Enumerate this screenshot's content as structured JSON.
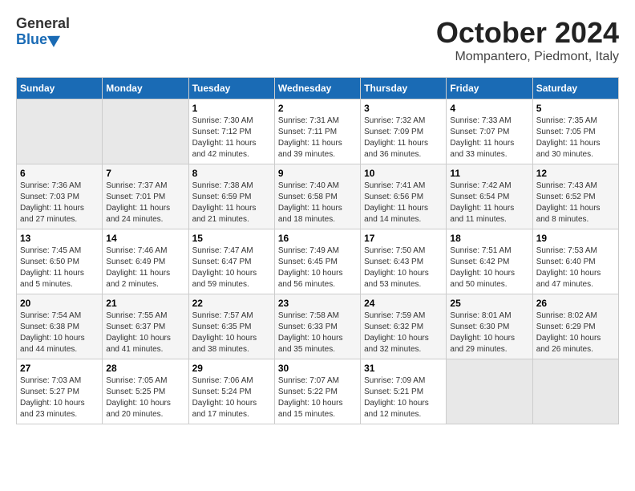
{
  "header": {
    "logo_general": "General",
    "logo_blue": "Blue",
    "title": "October 2024",
    "subtitle": "Mompantero, Piedmont, Italy"
  },
  "columns": [
    "Sunday",
    "Monday",
    "Tuesday",
    "Wednesday",
    "Thursday",
    "Friday",
    "Saturday"
  ],
  "weeks": [
    [
      {
        "day": "",
        "sunrise": "",
        "sunset": "",
        "daylight": "",
        "empty": true
      },
      {
        "day": "",
        "sunrise": "",
        "sunset": "",
        "daylight": "",
        "empty": true
      },
      {
        "day": "1",
        "sunrise": "Sunrise: 7:30 AM",
        "sunset": "Sunset: 7:12 PM",
        "daylight": "Daylight: 11 hours and 42 minutes."
      },
      {
        "day": "2",
        "sunrise": "Sunrise: 7:31 AM",
        "sunset": "Sunset: 7:11 PM",
        "daylight": "Daylight: 11 hours and 39 minutes."
      },
      {
        "day": "3",
        "sunrise": "Sunrise: 7:32 AM",
        "sunset": "Sunset: 7:09 PM",
        "daylight": "Daylight: 11 hours and 36 minutes."
      },
      {
        "day": "4",
        "sunrise": "Sunrise: 7:33 AM",
        "sunset": "Sunset: 7:07 PM",
        "daylight": "Daylight: 11 hours and 33 minutes."
      },
      {
        "day": "5",
        "sunrise": "Sunrise: 7:35 AM",
        "sunset": "Sunset: 7:05 PM",
        "daylight": "Daylight: 11 hours and 30 minutes."
      }
    ],
    [
      {
        "day": "6",
        "sunrise": "Sunrise: 7:36 AM",
        "sunset": "Sunset: 7:03 PM",
        "daylight": "Daylight: 11 hours and 27 minutes."
      },
      {
        "day": "7",
        "sunrise": "Sunrise: 7:37 AM",
        "sunset": "Sunset: 7:01 PM",
        "daylight": "Daylight: 11 hours and 24 minutes."
      },
      {
        "day": "8",
        "sunrise": "Sunrise: 7:38 AM",
        "sunset": "Sunset: 6:59 PM",
        "daylight": "Daylight: 11 hours and 21 minutes."
      },
      {
        "day": "9",
        "sunrise": "Sunrise: 7:40 AM",
        "sunset": "Sunset: 6:58 PM",
        "daylight": "Daylight: 11 hours and 18 minutes."
      },
      {
        "day": "10",
        "sunrise": "Sunrise: 7:41 AM",
        "sunset": "Sunset: 6:56 PM",
        "daylight": "Daylight: 11 hours and 14 minutes."
      },
      {
        "day": "11",
        "sunrise": "Sunrise: 7:42 AM",
        "sunset": "Sunset: 6:54 PM",
        "daylight": "Daylight: 11 hours and 11 minutes."
      },
      {
        "day": "12",
        "sunrise": "Sunrise: 7:43 AM",
        "sunset": "Sunset: 6:52 PM",
        "daylight": "Daylight: 11 hours and 8 minutes."
      }
    ],
    [
      {
        "day": "13",
        "sunrise": "Sunrise: 7:45 AM",
        "sunset": "Sunset: 6:50 PM",
        "daylight": "Daylight: 11 hours and 5 minutes."
      },
      {
        "day": "14",
        "sunrise": "Sunrise: 7:46 AM",
        "sunset": "Sunset: 6:49 PM",
        "daylight": "Daylight: 11 hours and 2 minutes."
      },
      {
        "day": "15",
        "sunrise": "Sunrise: 7:47 AM",
        "sunset": "Sunset: 6:47 PM",
        "daylight": "Daylight: 10 hours and 59 minutes."
      },
      {
        "day": "16",
        "sunrise": "Sunrise: 7:49 AM",
        "sunset": "Sunset: 6:45 PM",
        "daylight": "Daylight: 10 hours and 56 minutes."
      },
      {
        "day": "17",
        "sunrise": "Sunrise: 7:50 AM",
        "sunset": "Sunset: 6:43 PM",
        "daylight": "Daylight: 10 hours and 53 minutes."
      },
      {
        "day": "18",
        "sunrise": "Sunrise: 7:51 AM",
        "sunset": "Sunset: 6:42 PM",
        "daylight": "Daylight: 10 hours and 50 minutes."
      },
      {
        "day": "19",
        "sunrise": "Sunrise: 7:53 AM",
        "sunset": "Sunset: 6:40 PM",
        "daylight": "Daylight: 10 hours and 47 minutes."
      }
    ],
    [
      {
        "day": "20",
        "sunrise": "Sunrise: 7:54 AM",
        "sunset": "Sunset: 6:38 PM",
        "daylight": "Daylight: 10 hours and 44 minutes."
      },
      {
        "day": "21",
        "sunrise": "Sunrise: 7:55 AM",
        "sunset": "Sunset: 6:37 PM",
        "daylight": "Daylight: 10 hours and 41 minutes."
      },
      {
        "day": "22",
        "sunrise": "Sunrise: 7:57 AM",
        "sunset": "Sunset: 6:35 PM",
        "daylight": "Daylight: 10 hours and 38 minutes."
      },
      {
        "day": "23",
        "sunrise": "Sunrise: 7:58 AM",
        "sunset": "Sunset: 6:33 PM",
        "daylight": "Daylight: 10 hours and 35 minutes."
      },
      {
        "day": "24",
        "sunrise": "Sunrise: 7:59 AM",
        "sunset": "Sunset: 6:32 PM",
        "daylight": "Daylight: 10 hours and 32 minutes."
      },
      {
        "day": "25",
        "sunrise": "Sunrise: 8:01 AM",
        "sunset": "Sunset: 6:30 PM",
        "daylight": "Daylight: 10 hours and 29 minutes."
      },
      {
        "day": "26",
        "sunrise": "Sunrise: 8:02 AM",
        "sunset": "Sunset: 6:29 PM",
        "daylight": "Daylight: 10 hours and 26 minutes."
      }
    ],
    [
      {
        "day": "27",
        "sunrise": "Sunrise: 7:03 AM",
        "sunset": "Sunset: 5:27 PM",
        "daylight": "Daylight: 10 hours and 23 minutes."
      },
      {
        "day": "28",
        "sunrise": "Sunrise: 7:05 AM",
        "sunset": "Sunset: 5:25 PM",
        "daylight": "Daylight: 10 hours and 20 minutes."
      },
      {
        "day": "29",
        "sunrise": "Sunrise: 7:06 AM",
        "sunset": "Sunset: 5:24 PM",
        "daylight": "Daylight: 10 hours and 17 minutes."
      },
      {
        "day": "30",
        "sunrise": "Sunrise: 7:07 AM",
        "sunset": "Sunset: 5:22 PM",
        "daylight": "Daylight: 10 hours and 15 minutes."
      },
      {
        "day": "31",
        "sunrise": "Sunrise: 7:09 AM",
        "sunset": "Sunset: 5:21 PM",
        "daylight": "Daylight: 10 hours and 12 minutes."
      },
      {
        "day": "",
        "sunrise": "",
        "sunset": "",
        "daylight": "",
        "empty": true
      },
      {
        "day": "",
        "sunrise": "",
        "sunset": "",
        "daylight": "",
        "empty": true
      }
    ]
  ]
}
